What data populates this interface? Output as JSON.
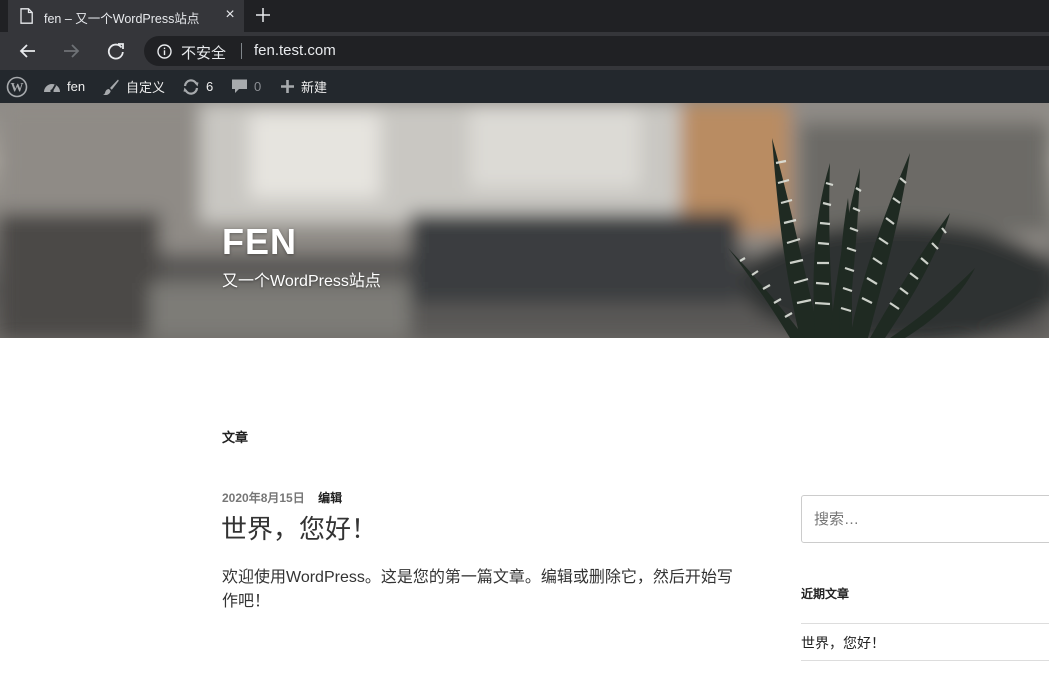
{
  "browser": {
    "tab_title": "fen – 又一个WordPress站点",
    "tab_close": "×",
    "omnibox": {
      "security_label": "不安全",
      "url": "fen.test.com"
    }
  },
  "admin_bar": {
    "site_name": "fen",
    "customize": "自定义",
    "updates_count": "6",
    "comments_count": "0",
    "new": "新建"
  },
  "header": {
    "site_title": "FEN",
    "site_description": "又一个WordPress站点"
  },
  "main": {
    "page_heading": "文章",
    "post": {
      "date": "2020年8月15日",
      "edit": "编辑",
      "title": "世界，您好！",
      "excerpt": "欢迎使用WordPress。这是您的第一篇文章。编辑或删除它，然后开始写作吧！"
    }
  },
  "sidebar": {
    "search_placeholder": "搜索…",
    "recent_posts_title": "近期文章",
    "recent_posts": [
      "世界，您好！"
    ]
  }
}
